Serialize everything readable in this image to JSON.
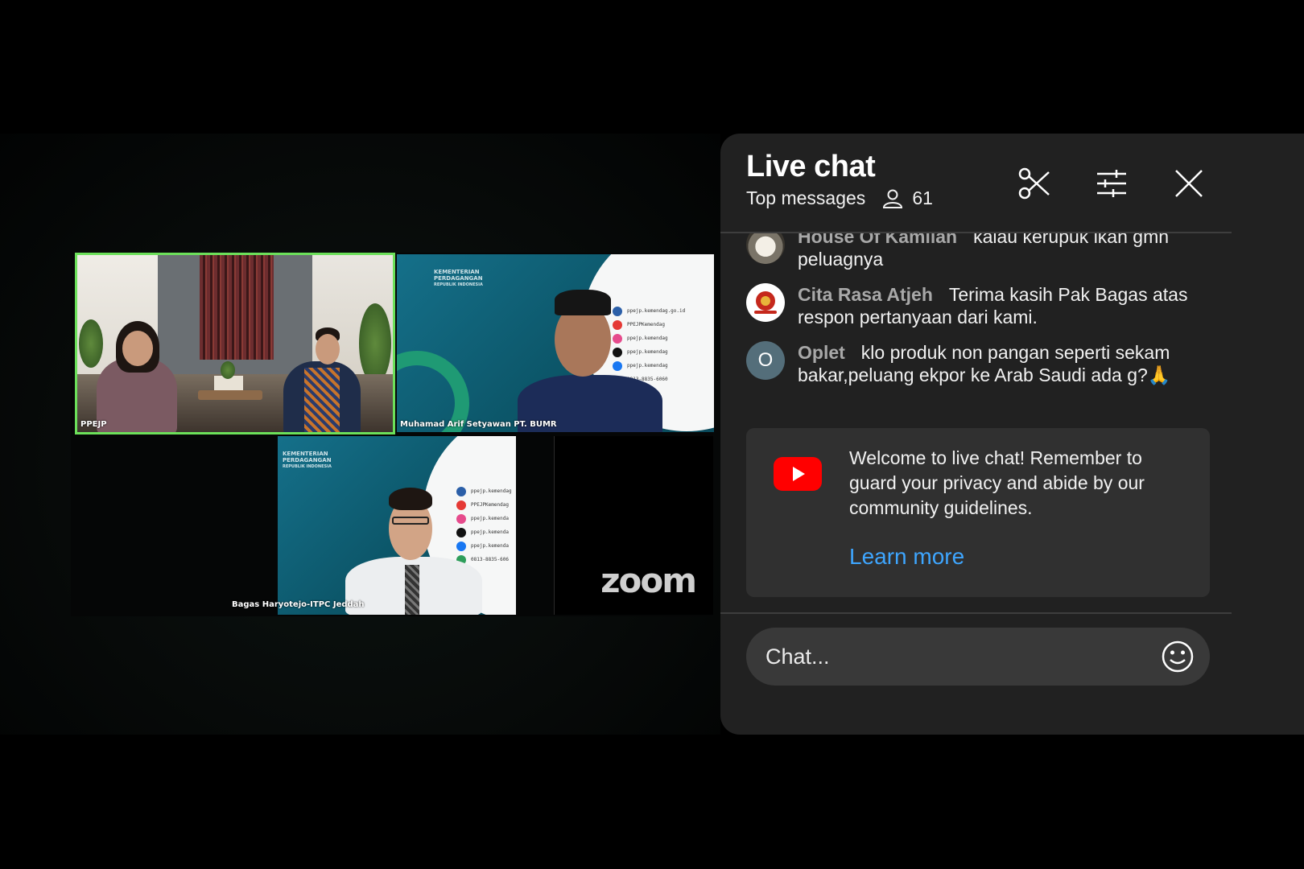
{
  "video": {
    "tiles": [
      {
        "name": "PPEJP"
      },
      {
        "name": "Muhamad Arif Setyawan PT. BUMR"
      },
      {
        "name": "Bagas Haryotejo-ITPC Jeddah"
      }
    ],
    "slide": {
      "logo_lines": [
        "KEMENTERIAN",
        "PERDAGANGAN",
        "REPUBLIK INDONESIA"
      ],
      "socials_arif": [
        "ppejp.kemendag.go.id",
        "PPEJPKemendag",
        "ppejp.kemendag",
        "ppejp.kemendag",
        "ppejp.kemendag",
        "0813-8835-6060"
      ],
      "socials_bagas": [
        "ppejp.kemendag",
        "PPEJPKemendag",
        "ppejp.kemenda",
        "ppejp.kemenda",
        "ppejp.kemenda",
        "0813-8835-606"
      ]
    },
    "zoom_logo": "zoom"
  },
  "chat": {
    "title": "Live chat",
    "subtitle": "Top messages",
    "viewer_count": "61",
    "messages": [
      {
        "author": "House Of Kamilah",
        "text": "kalau kerupuk ikan gmn peluagnya",
        "avatar": "photo"
      },
      {
        "author": "Cita Rasa Atjeh",
        "text": "Terima kasih Pak Bagas atas respon pertanyaan dari kami.",
        "avatar": "logo"
      },
      {
        "author": "Oplet",
        "text": "klo produk non pangan seperti sekam bakar,peluang ekpor ke Arab Saudi ada g?🙏",
        "avatar": "O"
      }
    ],
    "welcome": {
      "text": "Welcome to live chat! Remember to guard your privacy and abide by our community guidelines.",
      "link": "Learn more"
    },
    "input_placeholder": "Chat..."
  },
  "icons": {
    "scissors": "scissors-icon",
    "filter": "sliders-icon",
    "close": "close-icon",
    "viewers": "person-icon",
    "emoji": "smiley-icon",
    "youtube": "youtube-icon"
  },
  "colors": {
    "panel_bg": "#212121",
    "card_bg": "#303030",
    "link": "#3ea6ff",
    "active_speaker": "#6ce05a",
    "youtube_red": "#ff0000"
  }
}
